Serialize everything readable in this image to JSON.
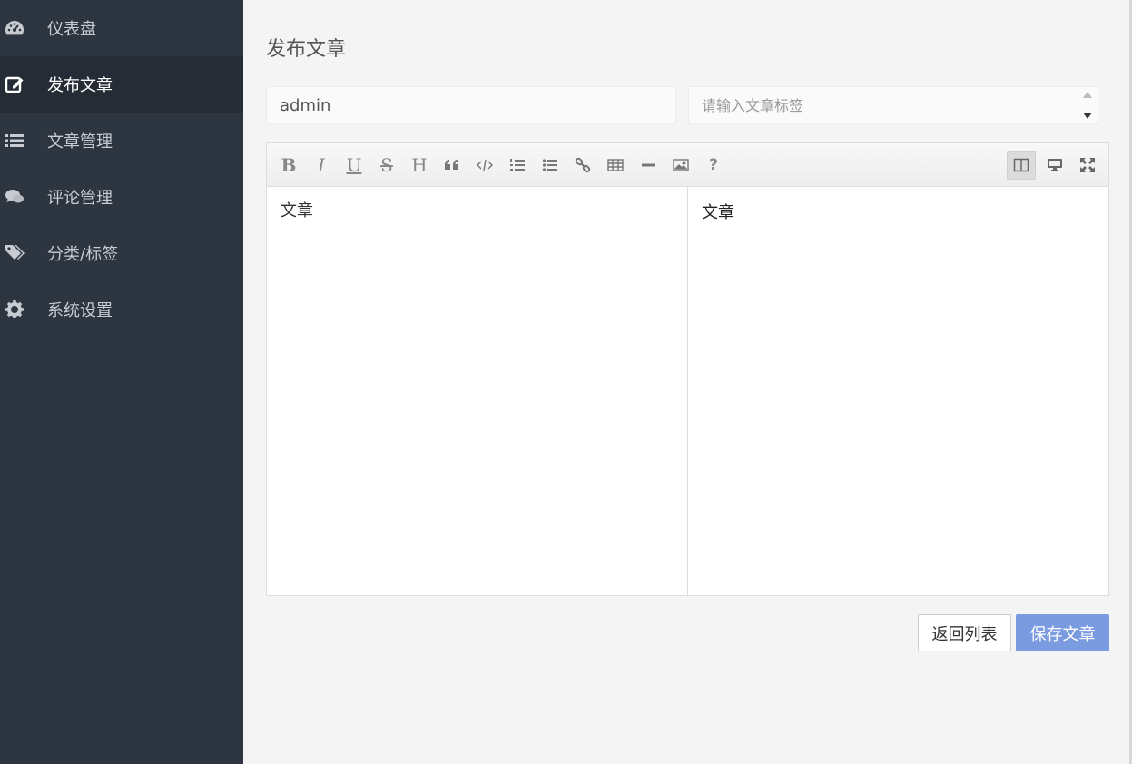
{
  "sidebar": {
    "items": [
      {
        "label": "仪表盘",
        "icon": "dashboard-icon"
      },
      {
        "label": "发布文章",
        "icon": "edit-icon",
        "active": true
      },
      {
        "label": "文章管理",
        "icon": "list-icon"
      },
      {
        "label": "评论管理",
        "icon": "comments-icon"
      },
      {
        "label": "分类/标签",
        "icon": "tags-icon"
      },
      {
        "label": "系统设置",
        "icon": "gear-icon"
      }
    ]
  },
  "page": {
    "title": "发布文章"
  },
  "form": {
    "author_value": "admin",
    "tags_placeholder": "请输入文章标签"
  },
  "editor": {
    "toolbar": [
      "bold",
      "italic",
      "underline",
      "strikethrough",
      "heading",
      "quote",
      "code",
      "ordered-list",
      "unordered-list",
      "link",
      "table",
      "horizontal-rule",
      "image",
      "help",
      "side-by-side",
      "preview",
      "fullscreen"
    ],
    "content": "文章",
    "preview": "文章"
  },
  "actions": {
    "back_label": "返回列表",
    "save_label": "保存文章"
  },
  "colors": {
    "sidebar_bg": "#2d3540",
    "sidebar_active": "#252c35",
    "primary": "#7b9be0"
  }
}
